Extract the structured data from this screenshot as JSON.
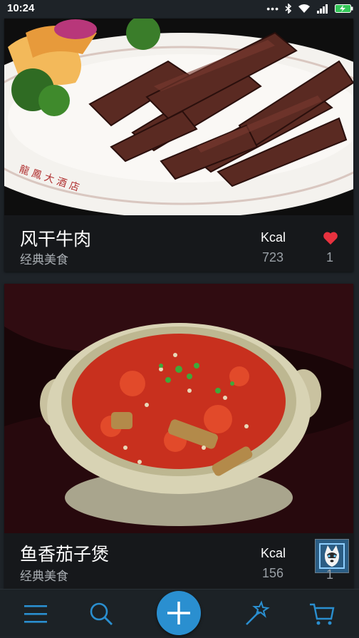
{
  "status_bar": {
    "time": "10:24",
    "icons": [
      "more-dots-icon",
      "bluetooth-icon",
      "wifi-icon",
      "signal-icon",
      "battery-charging-icon"
    ]
  },
  "feed": {
    "cards": [
      {
        "image": "air-dried-beef-photo",
        "title": "风干牛肉",
        "subtitle": "经典美食",
        "kcal_label": "Kcal",
        "kcal_value": "723",
        "like_icon": "heart-icon",
        "like_count": "1"
      },
      {
        "image": "eggplant-clay-pot-photo",
        "title": "鱼香茄子煲",
        "subtitle": "经典美食",
        "kcal_label": "Kcal",
        "kcal_value": "156",
        "avatar_icon": "husky-avatar",
        "like_count": "1"
      }
    ]
  },
  "bottom_nav": {
    "items": [
      "menu-icon",
      "search-icon",
      "add-icon",
      "magic-wand-icon",
      "cart-icon"
    ],
    "accent_color": "#2a8fd0"
  }
}
